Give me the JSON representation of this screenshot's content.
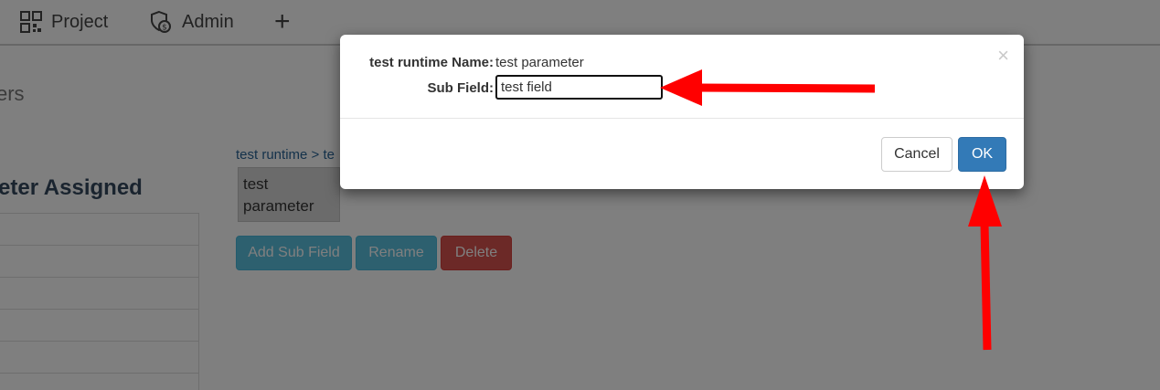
{
  "navbar": {
    "project_label": "Project",
    "admin_label": "Admin",
    "add_label": "+"
  },
  "page": {
    "heading": "ers",
    "section_title": "eter Assigned",
    "table_rows": [
      "",
      "",
      "",
      "",
      "",
      ""
    ],
    "breadcrumb": "test runtime > te",
    "selected_item": "test parameter",
    "buttons": {
      "add_sub_field": "Add Sub Field",
      "rename": "Rename",
      "delete": "Delete"
    }
  },
  "modal": {
    "close_label": "×",
    "name_label": "test runtime Name:",
    "name_value": "test parameter",
    "sub_field_label": "Sub Field:",
    "sub_field_value": "test field",
    "cancel_label": "Cancel",
    "ok_label": "OK"
  },
  "colors": {
    "primary": "#337ab7",
    "info": "#5bc0de",
    "danger": "#d9534f",
    "annotation_arrow": "#ff0000"
  },
  "icons": {
    "project": "qr-grid-icon",
    "admin": "admin-shield-icon",
    "add": "plus-icon",
    "close": "close-icon"
  }
}
